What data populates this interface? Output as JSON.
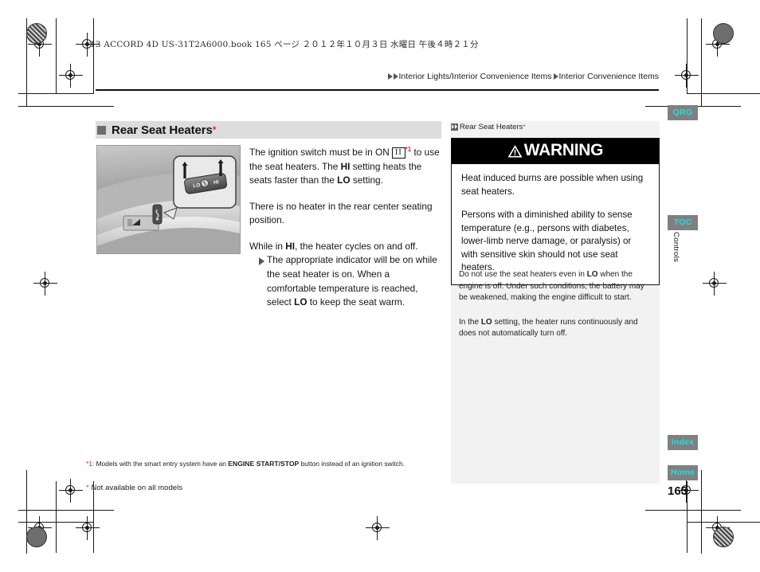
{
  "print_header": {
    "book_line": "13 ACCORD 4D US-31T2A6000.book   165 ページ   ２０１２年１０月３日   水曜日   午後４時２１分"
  },
  "breadcrumb": {
    "level1": "Interior Lights/Interior Convenience Items",
    "level2": "Interior Convenience Items"
  },
  "section": {
    "title": "Rear Seat Heaters",
    "title_asterisk": "*"
  },
  "figure": {
    "caption": "",
    "switch_labels": {
      "lo": "LO",
      "hi": "HI"
    }
  },
  "body": {
    "p1_a": "The ignition switch must be in ON ",
    "p1_ign_glyph": "II",
    "p1_footnote_ref": "*1",
    "p1_b": " to use the seat heaters. The ",
    "p1_hi": "HI",
    "p1_c": " setting heats the seats faster than the ",
    "p1_lo": "LO",
    "p1_d": " setting.",
    "p2": "There is no heater in the rear center seating position.",
    "p3_a": "While in ",
    "p3_hi": "HI",
    "p3_b": ", the heater cycles on and off.",
    "p3_sub_a": "The appropriate indicator will be on while the seat heater is on. When a comfortable temperature is reached, select ",
    "p3_sub_lo": "LO",
    "p3_sub_b": " to keep the seat warm."
  },
  "footnotes": {
    "fn1_marker": "*1:",
    "fn1_a": " Models with the smart entry system have an ",
    "fn1_bold": "ENGINE START/STOP",
    "fn1_b": " button instead of an ignition switch.",
    "fn2_marker": "*",
    "fn2_text": " Not available on all models"
  },
  "side": {
    "ref_label": "Rear Seat Heaters",
    "ref_asterisk": "*",
    "warning_title": "WARNING",
    "warning_p1": "Heat induced burns are possible when using seat heaters.",
    "warning_p2": "Persons with a diminished ability to sense temperature (e.g., persons with diabetes, lower-limb nerve damage, or paralysis) or with sensitive skin should not use seat heaters.",
    "note1_a": "Do not use the seat heaters even in ",
    "note1_lo": "LO",
    "note1_b": " when the engine is off. Under such conditions, the battery may be weakened, making the engine difficult to start.",
    "note2_a": "In the ",
    "note2_lo": "LO",
    "note2_b": " setting, the heater runs continuously and does not automatically turn off."
  },
  "nav": {
    "qrg": "QRG",
    "toc": "TOC",
    "index": "Index",
    "home": "Home",
    "chapter": "Controls",
    "page_number": "165"
  },
  "colors": {
    "tab_bg": "#808080",
    "tab_text": "#20e0e0",
    "asterisk_red": "#e8273c",
    "title_bar_bg": "#dcdcdc",
    "side_panel_bg": "#f2f2f2"
  }
}
